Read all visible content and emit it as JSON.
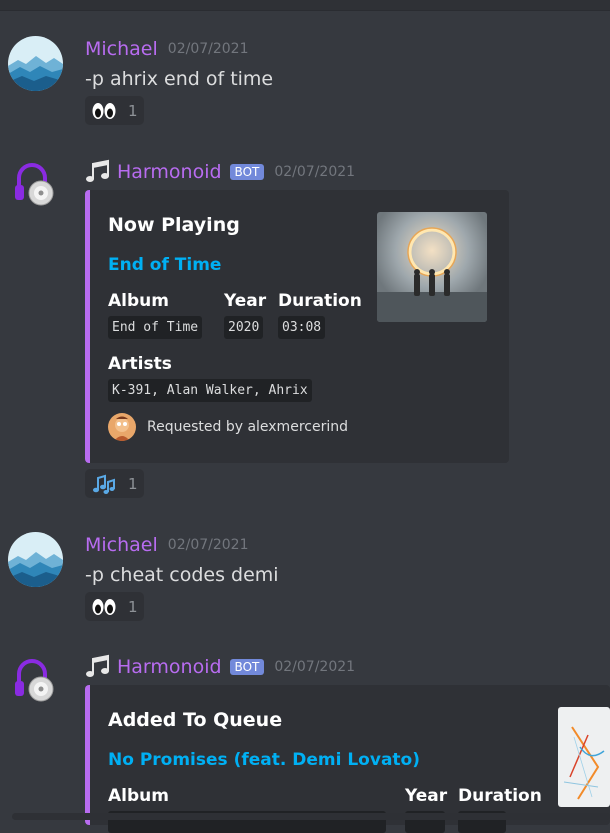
{
  "messages": [
    {
      "author": "Michael",
      "timestamp": "02/07/2021",
      "content": "-p ahrix end of time",
      "reaction": {
        "emoji": "eyes-emoji",
        "count": "1"
      }
    },
    {
      "author": "Harmonoid",
      "bot_tag": "BOT",
      "timestamp": "02/07/2021",
      "embed": {
        "title": "Now Playing",
        "track": "End of Time",
        "fields": {
          "album_label": "Album",
          "album": "End of Time",
          "year_label": "Year",
          "year": "2020",
          "duration_label": "Duration",
          "duration": "03:08",
          "artists_label": "Artists",
          "artists": "K-391, Alan Walker, Ahrix"
        },
        "footer": "Requested by alexmercerind"
      },
      "reaction": {
        "emoji": "notes-emoji",
        "count": "1"
      }
    },
    {
      "author": "Michael",
      "timestamp": "02/07/2021",
      "content": "-p cheat codes demi",
      "reaction": {
        "emoji": "eyes-emoji",
        "count": "1"
      }
    },
    {
      "author": "Harmonoid",
      "bot_tag": "BOT",
      "timestamp": "02/07/2021",
      "embed": {
        "title": "Added To Queue",
        "track": "No Promises (feat. Demi Lovato)",
        "fields": {
          "album_label": "Album",
          "year_label": "Year",
          "duration_label": "Duration"
        }
      }
    }
  ],
  "colors": {
    "background": "#36393f",
    "embed_bg": "#2f3136",
    "accent": "#b86cf0",
    "link": "#00b0f4",
    "bot_tag": "#7289da"
  }
}
